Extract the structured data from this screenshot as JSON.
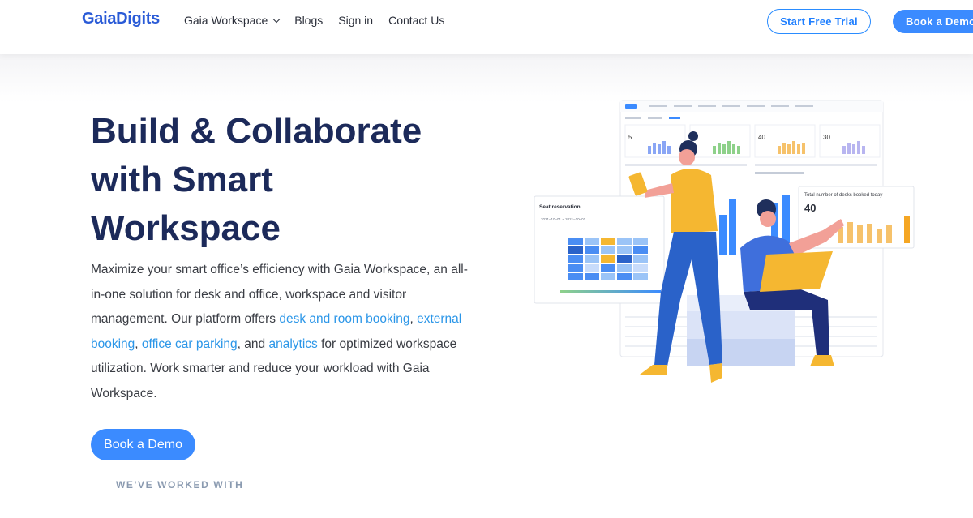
{
  "header": {
    "logo": "GaiaDigits",
    "nav": [
      {
        "label": "Gaia Workspace",
        "has_dropdown": true
      },
      {
        "label": "Blogs"
      },
      {
        "label": "Sign in"
      },
      {
        "label": "Contact Us"
      }
    ],
    "trial_button": "Start Free Trial",
    "demo_button": "Book a Demo"
  },
  "hero": {
    "title_lines": [
      "Build & Collaborate",
      "with Smart",
      "Workspace"
    ],
    "description": {
      "p1": "Maximize your smart office’s efficiency with Gaia Workspace, an all-in-one solution for desk and office, workspace and visitor management. Our platform offers ",
      "link1": "desk and room booking",
      "p2": ", ",
      "link2": "external booking",
      "p3": ", ",
      "link3": "office car parking",
      "p4": ", and ",
      "link4": "analytics",
      "p5": " for optimized workspace utilization. Work smarter and reduce your workload with Gaia Workspace."
    },
    "cta": "Book a Demo",
    "worked_with": "WE'VE WORKED WITH"
  },
  "illustration": {
    "seat_card_title": "Seat reservation",
    "seat_card_date": "2021–10–01 ~ 2021–10–01",
    "kpi_card_title": "Total number of desks booked today",
    "kpi_card_value": "40",
    "dash_kpis": [
      "5",
      "",
      "40",
      "30"
    ],
    "colors": {
      "accent": "#3b8bff",
      "title": "#1c2a5a",
      "link": "#2b96e8",
      "shirt_yellow": "#f5b731",
      "pants_blue": "#2a62c9"
    }
  }
}
